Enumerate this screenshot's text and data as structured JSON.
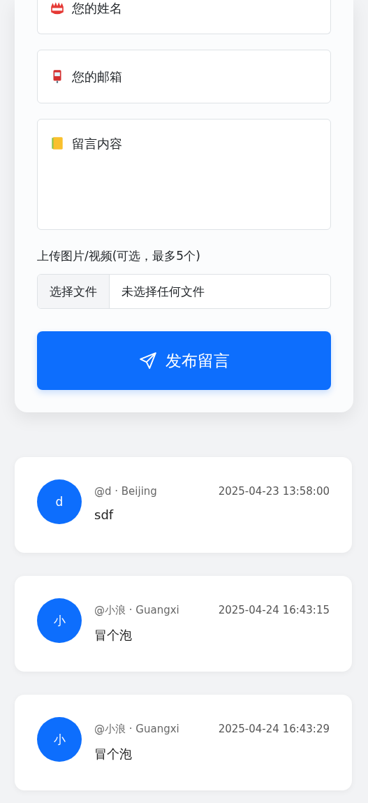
{
  "form": {
    "fields": [
      {
        "kind": "input",
        "placeholder": "您的姓名"
      },
      {
        "kind": "input",
        "placeholder": "您的邮箱"
      },
      {
        "kind": "textarea",
        "placeholder": "留言内容"
      }
    ],
    "upload": {
      "label": "上传图片/视频(可选，最多5个)",
      "button": "选择文件",
      "status": "未选择任何文件"
    },
    "submit": "发布留言"
  },
  "comments": [
    {
      "avatar": "d",
      "user": "@d · Beijing",
      "time": "2025-04-23 13:58:00",
      "content": "sdf"
    },
    {
      "avatar": "小",
      "user": "@小浪 · Guangxi",
      "time": "2025-04-24 16:43:15",
      "content": "冒个泡"
    },
    {
      "avatar": "小",
      "user": "@小浪 · Guangxi",
      "time": "2025-04-24 16:43:29",
      "content": "冒个泡"
    }
  ]
}
